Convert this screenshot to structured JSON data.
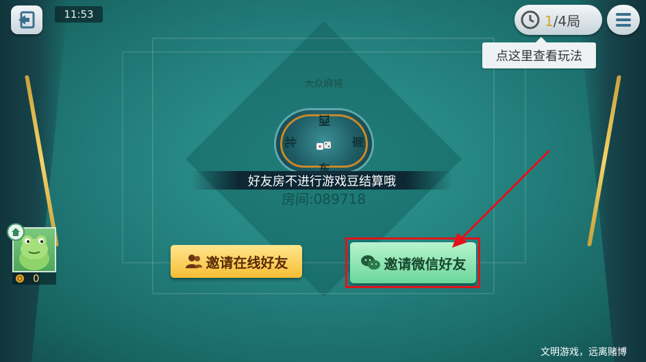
{
  "hud": {
    "time": "11:53",
    "round": {
      "current": "1",
      "total": "/4局"
    },
    "tooltip": "点这里查看玩法"
  },
  "table": {
    "game_name": "大众麻将",
    "compass": {
      "north": "北",
      "west": "西",
      "south": "南",
      "east": "东"
    },
    "notice": "好友房不进行游戏豆结算哦",
    "room_id": "房间:089718"
  },
  "buttons": {
    "invite_online": "邀请在线好友",
    "invite_wechat": "邀请微信好友"
  },
  "player": {
    "coins": "0"
  },
  "footer": {
    "slogan": "文明游戏，远离赌博"
  },
  "colors": {
    "felt": "#237f7c",
    "invite_online": "#f6bd35",
    "invite_wechat": "#6bd79a",
    "highlight": "#e3121a",
    "round_accent": "#d9a21e"
  },
  "icons": [
    "exit-icon",
    "clock-icon",
    "menu-icon",
    "people-icon",
    "wechat-icon",
    "home-icon",
    "coin-icon",
    "dice-icon"
  ]
}
